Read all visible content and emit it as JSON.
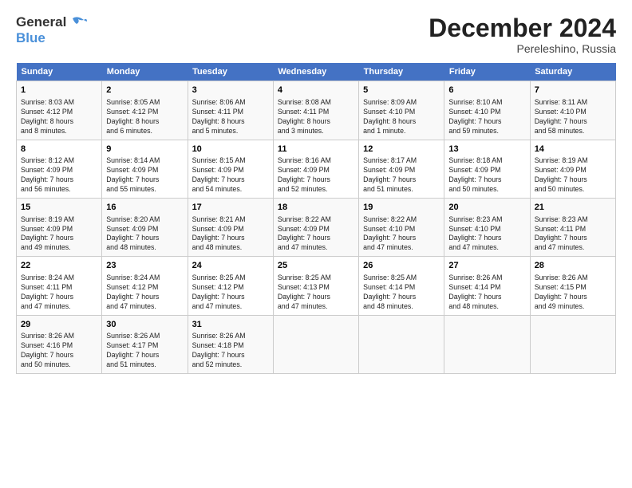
{
  "header": {
    "logo_line1": "General",
    "logo_line2": "Blue",
    "month_title": "December 2024",
    "location": "Pereleshino, Russia"
  },
  "weekdays": [
    "Sunday",
    "Monday",
    "Tuesday",
    "Wednesday",
    "Thursday",
    "Friday",
    "Saturday"
  ],
  "weeks": [
    [
      {
        "day": "1",
        "info": "Sunrise: 8:03 AM\nSunset: 4:12 PM\nDaylight: 8 hours\nand 8 minutes."
      },
      {
        "day": "2",
        "info": "Sunrise: 8:05 AM\nSunset: 4:12 PM\nDaylight: 8 hours\nand 6 minutes."
      },
      {
        "day": "3",
        "info": "Sunrise: 8:06 AM\nSunset: 4:11 PM\nDaylight: 8 hours\nand 5 minutes."
      },
      {
        "day": "4",
        "info": "Sunrise: 8:08 AM\nSunset: 4:11 PM\nDaylight: 8 hours\nand 3 minutes."
      },
      {
        "day": "5",
        "info": "Sunrise: 8:09 AM\nSunset: 4:10 PM\nDaylight: 8 hours\nand 1 minute."
      },
      {
        "day": "6",
        "info": "Sunrise: 8:10 AM\nSunset: 4:10 PM\nDaylight: 7 hours\nand 59 minutes."
      },
      {
        "day": "7",
        "info": "Sunrise: 8:11 AM\nSunset: 4:10 PM\nDaylight: 7 hours\nand 58 minutes."
      }
    ],
    [
      {
        "day": "8",
        "info": "Sunrise: 8:12 AM\nSunset: 4:09 PM\nDaylight: 7 hours\nand 56 minutes."
      },
      {
        "day": "9",
        "info": "Sunrise: 8:14 AM\nSunset: 4:09 PM\nDaylight: 7 hours\nand 55 minutes."
      },
      {
        "day": "10",
        "info": "Sunrise: 8:15 AM\nSunset: 4:09 PM\nDaylight: 7 hours\nand 54 minutes."
      },
      {
        "day": "11",
        "info": "Sunrise: 8:16 AM\nSunset: 4:09 PM\nDaylight: 7 hours\nand 52 minutes."
      },
      {
        "day": "12",
        "info": "Sunrise: 8:17 AM\nSunset: 4:09 PM\nDaylight: 7 hours\nand 51 minutes."
      },
      {
        "day": "13",
        "info": "Sunrise: 8:18 AM\nSunset: 4:09 PM\nDaylight: 7 hours\nand 50 minutes."
      },
      {
        "day": "14",
        "info": "Sunrise: 8:19 AM\nSunset: 4:09 PM\nDaylight: 7 hours\nand 50 minutes."
      }
    ],
    [
      {
        "day": "15",
        "info": "Sunrise: 8:19 AM\nSunset: 4:09 PM\nDaylight: 7 hours\nand 49 minutes."
      },
      {
        "day": "16",
        "info": "Sunrise: 8:20 AM\nSunset: 4:09 PM\nDaylight: 7 hours\nand 48 minutes."
      },
      {
        "day": "17",
        "info": "Sunrise: 8:21 AM\nSunset: 4:09 PM\nDaylight: 7 hours\nand 48 minutes."
      },
      {
        "day": "18",
        "info": "Sunrise: 8:22 AM\nSunset: 4:09 PM\nDaylight: 7 hours\nand 47 minutes."
      },
      {
        "day": "19",
        "info": "Sunrise: 8:22 AM\nSunset: 4:10 PM\nDaylight: 7 hours\nand 47 minutes."
      },
      {
        "day": "20",
        "info": "Sunrise: 8:23 AM\nSunset: 4:10 PM\nDaylight: 7 hours\nand 47 minutes."
      },
      {
        "day": "21",
        "info": "Sunrise: 8:23 AM\nSunset: 4:11 PM\nDaylight: 7 hours\nand 47 minutes."
      }
    ],
    [
      {
        "day": "22",
        "info": "Sunrise: 8:24 AM\nSunset: 4:11 PM\nDaylight: 7 hours\nand 47 minutes."
      },
      {
        "day": "23",
        "info": "Sunrise: 8:24 AM\nSunset: 4:12 PM\nDaylight: 7 hours\nand 47 minutes."
      },
      {
        "day": "24",
        "info": "Sunrise: 8:25 AM\nSunset: 4:12 PM\nDaylight: 7 hours\nand 47 minutes."
      },
      {
        "day": "25",
        "info": "Sunrise: 8:25 AM\nSunset: 4:13 PM\nDaylight: 7 hours\nand 47 minutes."
      },
      {
        "day": "26",
        "info": "Sunrise: 8:25 AM\nSunset: 4:14 PM\nDaylight: 7 hours\nand 48 minutes."
      },
      {
        "day": "27",
        "info": "Sunrise: 8:26 AM\nSunset: 4:14 PM\nDaylight: 7 hours\nand 48 minutes."
      },
      {
        "day": "28",
        "info": "Sunrise: 8:26 AM\nSunset: 4:15 PM\nDaylight: 7 hours\nand 49 minutes."
      }
    ],
    [
      {
        "day": "29",
        "info": "Sunrise: 8:26 AM\nSunset: 4:16 PM\nDaylight: 7 hours\nand 50 minutes."
      },
      {
        "day": "30",
        "info": "Sunrise: 8:26 AM\nSunset: 4:17 PM\nDaylight: 7 hours\nand 51 minutes."
      },
      {
        "day": "31",
        "info": "Sunrise: 8:26 AM\nSunset: 4:18 PM\nDaylight: 7 hours\nand 52 minutes."
      },
      {
        "day": "",
        "info": ""
      },
      {
        "day": "",
        "info": ""
      },
      {
        "day": "",
        "info": ""
      },
      {
        "day": "",
        "info": ""
      }
    ]
  ]
}
